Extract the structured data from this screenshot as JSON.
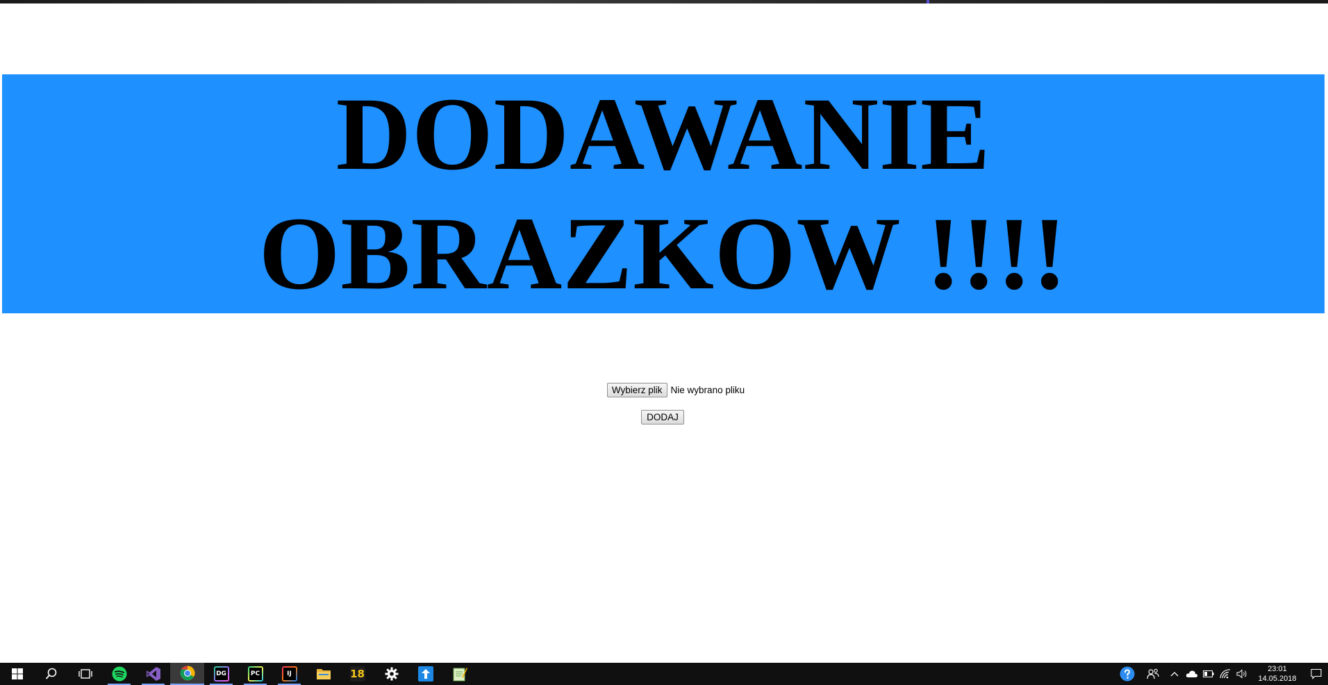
{
  "page": {
    "heading": "DODAWANIE OBRAZKOW !!!!",
    "banner_color": "#1e90ff"
  },
  "form": {
    "file_button_label": "Wybierz plik",
    "file_status": "Nie wybrano pliku",
    "submit_label": "DODAJ"
  },
  "taskbar": {
    "apps": [
      {
        "name": "start",
        "icon": "windows-icon"
      },
      {
        "name": "search",
        "icon": "search-icon"
      },
      {
        "name": "task-view",
        "icon": "task-view-icon"
      },
      {
        "name": "spotify",
        "icon": "spotify-icon"
      },
      {
        "name": "visual-studio",
        "icon": "visual-studio-icon"
      },
      {
        "name": "chrome",
        "icon": "chrome-icon"
      },
      {
        "name": "datagrip",
        "icon": "datagrip-icon",
        "label": "DG"
      },
      {
        "name": "pycharm",
        "icon": "pycharm-icon",
        "label": "PC"
      },
      {
        "name": "intellij",
        "icon": "intellij-icon",
        "label": "IJ"
      },
      {
        "name": "file-explorer",
        "icon": "folder-icon"
      },
      {
        "name": "app-18",
        "icon": "app-18-icon",
        "label": "18"
      },
      {
        "name": "settings",
        "icon": "gear-icon"
      },
      {
        "name": "upload-app",
        "icon": "upload-icon"
      },
      {
        "name": "notepad",
        "icon": "notepad-icon"
      }
    ],
    "clock": {
      "time": "23:01",
      "date": "14.05.2018"
    }
  }
}
